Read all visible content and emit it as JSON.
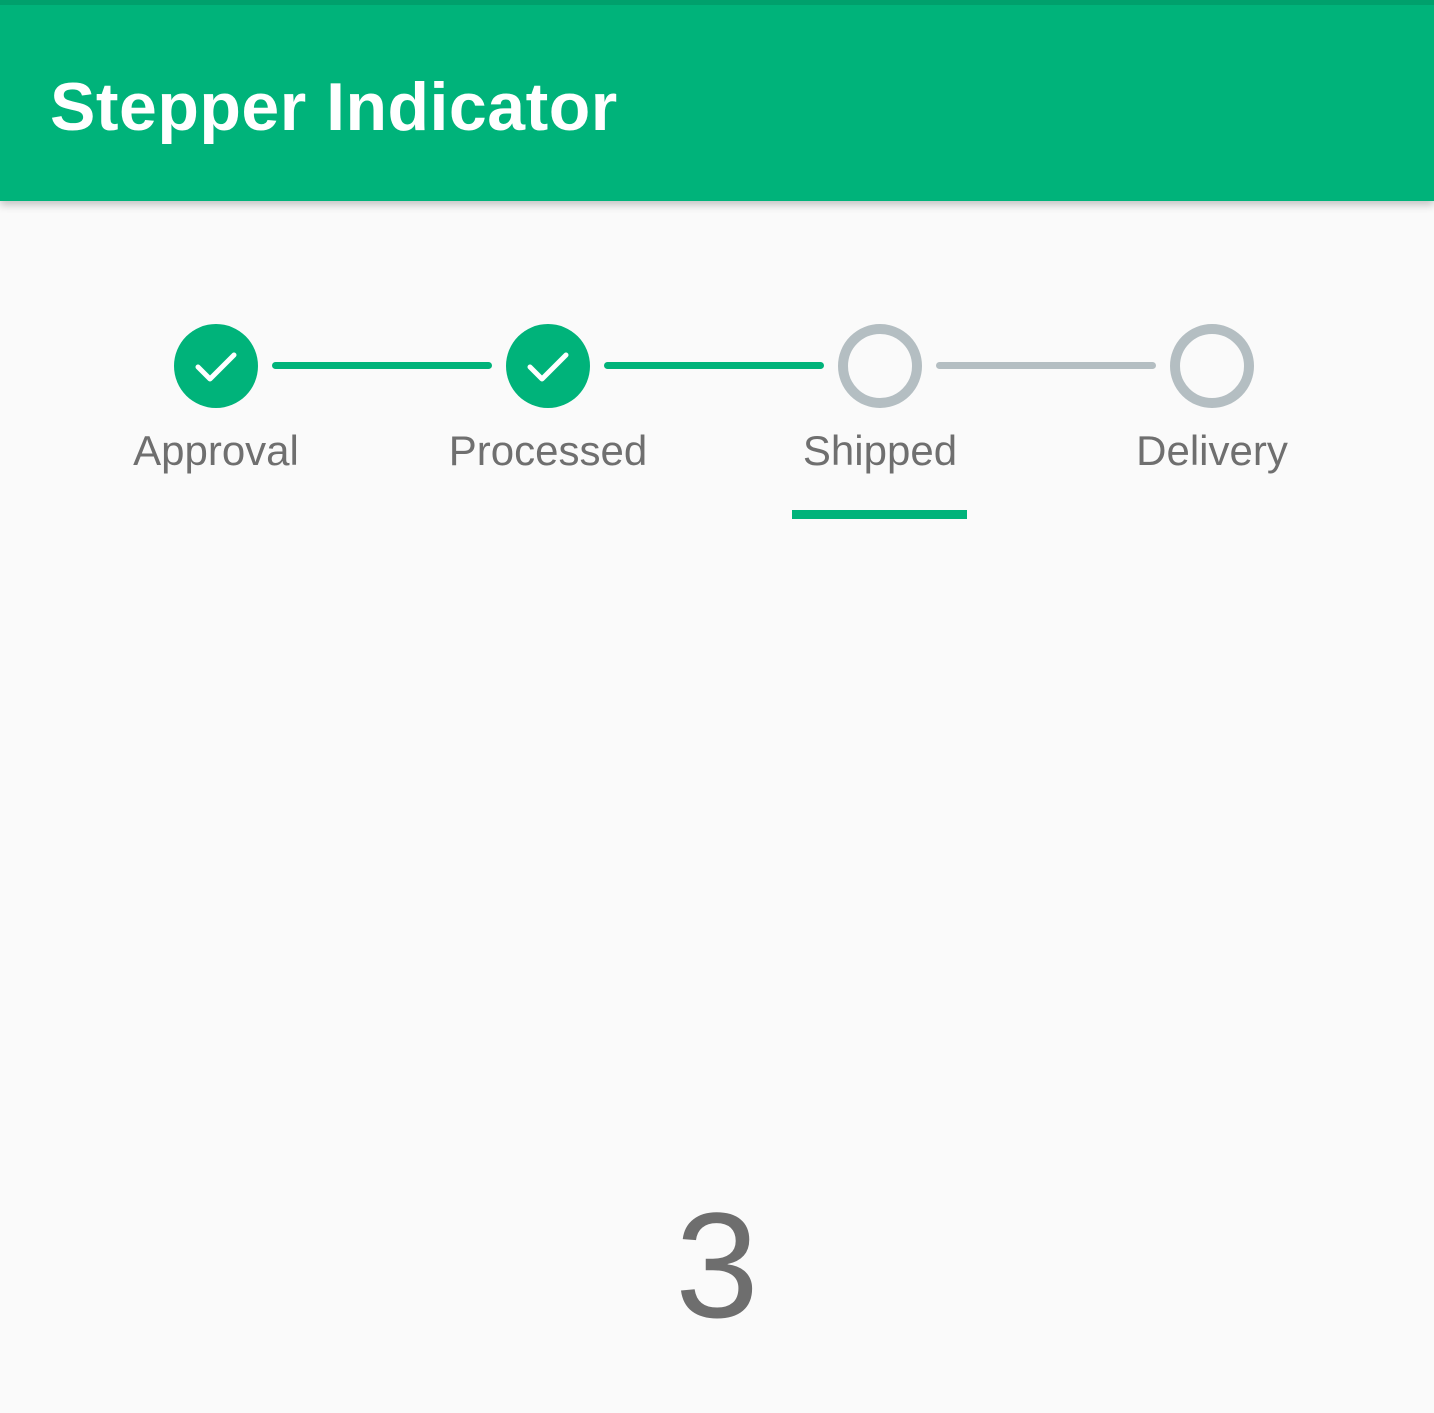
{
  "appbar": {
    "title": "Stepper Indicator"
  },
  "colors": {
    "primary": "#00b37a",
    "inactive": "#b4bec2",
    "label": "#6f6f6f",
    "background": "#fafafa"
  },
  "stepper": {
    "current_step": 3,
    "steps": [
      {
        "label": "Approval",
        "state": "completed",
        "icon": "check-icon"
      },
      {
        "label": "Processed",
        "state": "completed",
        "icon": "check-icon"
      },
      {
        "label": "Shipped",
        "state": "current",
        "icon": "empty-circle-icon"
      },
      {
        "label": "Delivery",
        "state": "pending",
        "icon": "empty-circle-icon"
      }
    ]
  },
  "content": {
    "page_number": "3"
  }
}
